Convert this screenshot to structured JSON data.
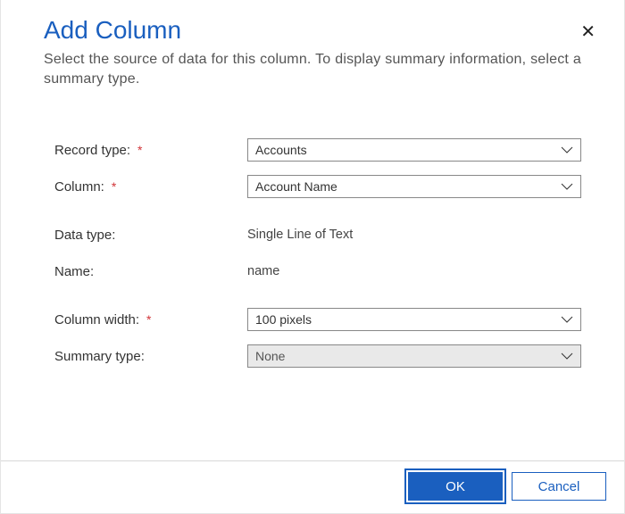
{
  "header": {
    "title": "Add Column",
    "subtitle": "Select the source of data for this column. To display summary information, select a summary type."
  },
  "form": {
    "record_type": {
      "label": "Record type:",
      "required": "*",
      "value": "Accounts"
    },
    "column": {
      "label": "Column:",
      "required": "*",
      "value": "Account Name"
    },
    "data_type": {
      "label": "Data type:",
      "value": "Single Line of Text"
    },
    "name": {
      "label": "Name:",
      "value": "name"
    },
    "column_width": {
      "label": "Column width:",
      "required": "*",
      "value": "100 pixels"
    },
    "summary_type": {
      "label": "Summary type:",
      "value": "None"
    }
  },
  "footer": {
    "ok": "OK",
    "cancel": "Cancel"
  }
}
